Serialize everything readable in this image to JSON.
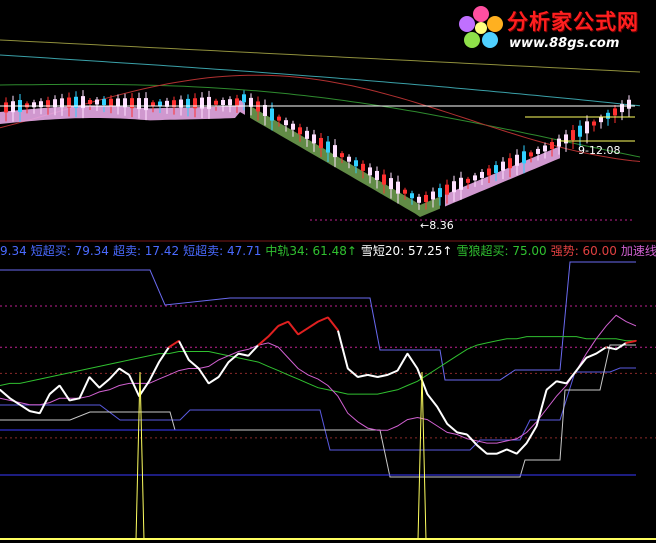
{
  "logo": {
    "title": "分析家公式网",
    "url": "www.88gs.com"
  },
  "colors": {
    "background": "#000000",
    "white_line": "#ffffff",
    "red_line": "#e02020",
    "violet_line": "#d060d0",
    "green_line": "#30c030",
    "blue_line": "#4a5aff",
    "yellow_line": "#ffff60",
    "ribbon_pink": "#e7a9e6",
    "ribbon_green": "#6b9a4e",
    "dotted_line": "#c0208f"
  },
  "price_panel": {
    "high_label": "9-12.08",
    "low_label": "8.36",
    "low_arrow": "←"
  },
  "legend": [
    {
      "text": "9.34",
      "color": "#4a6aff"
    },
    {
      "text": "短超买: 79.34",
      "color": "#4a6aff"
    },
    {
      "text": "超卖: 17.42",
      "color": "#4a6aff"
    },
    {
      "text": "短超卖: 47.71",
      "color": "#4a6aff"
    },
    {
      "text": "中轨34: 61.48↑",
      "color": "#30c030"
    },
    {
      "text": "雪短20: 57.25↑",
      "color": "#ffffff"
    },
    {
      "text": "雪狼超买: 75.00",
      "color": "#30c030"
    },
    {
      "text": "强势: 60.00",
      "color": "#e04040"
    },
    {
      "text": "加速线",
      "color": "#d060d0"
    }
  ],
  "chart_data": {
    "type": "line",
    "title": "",
    "xlabel": "",
    "ylabel": "",
    "ylim": [
      0,
      100
    ],
    "x_count": 65,
    "series": [
      {
        "name": "雪短20",
        "values": [
          40,
          36,
          33,
          30,
          29,
          38,
          42,
          35,
          36,
          46,
          41,
          45,
          50,
          47,
          37,
          44,
          53,
          60,
          63,
          54,
          50,
          43,
          46,
          53,
          57,
          56,
          61,
          65,
          70,
          72,
          66,
          69,
          72,
          74,
          68,
          50,
          46,
          47,
          46,
          47,
          49,
          57,
          50,
          38,
          32,
          24,
          20,
          19,
          14,
          10,
          10,
          12,
          10,
          15,
          23,
          40,
          44,
          43,
          49,
          55,
          57,
          60,
          59,
          62,
          63
        ]
      },
      {
        "name": "中轨34",
        "values": [
          42,
          43,
          43,
          44,
          45,
          46,
          47,
          48,
          49,
          50,
          51,
          52,
          53,
          54,
          55,
          56,
          57,
          57,
          58,
          58,
          58,
          58,
          57,
          56,
          55,
          54,
          53,
          51,
          49,
          47,
          45,
          43,
          41,
          40,
          39,
          38,
          38,
          38,
          38,
          39,
          40,
          42,
          44,
          47,
          50,
          53,
          56,
          59,
          61,
          62,
          63,
          64,
          64,
          65,
          65,
          65,
          65,
          65,
          65,
          64,
          64,
          64,
          64,
          63,
          63
        ]
      },
      {
        "name": "加速线",
        "values": [
          36,
          35,
          34,
          33,
          33,
          34,
          36,
          36,
          36,
          37,
          39,
          40,
          42,
          43,
          43,
          43,
          45,
          47,
          49,
          50,
          50,
          51,
          54,
          56,
          58,
          59,
          61,
          62,
          60,
          55,
          50,
          47,
          45,
          42,
          37,
          29,
          25,
          22,
          21,
          21,
          23,
          26,
          27,
          26,
          23,
          20,
          19,
          17,
          16,
          15,
          15,
          16,
          17,
          20,
          25,
          31,
          37,
          42,
          49,
          57,
          64,
          70,
          75,
          72,
          70
        ]
      },
      {
        "name": "强势",
        "values": [
          60,
          60,
          60,
          60,
          60,
          60,
          60,
          60,
          60,
          60,
          60,
          60,
          60,
          60,
          60,
          60,
          60,
          60,
          60,
          60,
          60,
          60,
          60,
          60,
          60,
          60,
          60,
          60,
          60,
          60,
          60,
          60,
          60,
          60,
          60,
          60,
          60,
          60,
          60,
          60,
          60,
          60,
          60,
          60,
          60,
          60,
          60,
          60,
          60,
          60,
          60,
          60,
          60,
          60,
          60,
          60,
          60,
          60,
          60,
          60,
          60,
          60,
          60,
          60,
          60
        ]
      },
      {
        "name": "雪狼超买",
        "values": [
          75,
          75,
          75,
          75,
          75,
          75,
          75,
          75,
          75,
          75,
          75,
          75,
          75,
          75,
          75,
          75,
          75,
          75,
          75,
          75,
          75,
          75,
          75,
          75,
          75,
          75,
          75,
          75,
          75,
          75,
          75,
          75,
          75,
          75,
          75,
          75,
          75,
          75,
          75,
          75,
          75,
          75,
          75,
          75,
          75,
          75,
          75,
          75,
          75,
          75,
          75,
          75,
          75,
          75,
          75,
          75,
          75,
          75,
          75,
          75,
          75,
          75,
          75,
          75,
          75
        ]
      },
      {
        "name": "短超买",
        "values": [
          79.34,
          79.34,
          79.34,
          79.34,
          79.34,
          79.34,
          79.34,
          79.34,
          79.34,
          79.34,
          79.34,
          79.34,
          79.34,
          79.34,
          79.34,
          79.34,
          79.34,
          79.34,
          79.34,
          79.34,
          79.34,
          79.34,
          79.34,
          79.34,
          79.34,
          79.34,
          79.34,
          79.34,
          79.34,
          79.34,
          79.34,
          79.34,
          79.34,
          79.34,
          79.34,
          79.34,
          79.34,
          79.34,
          79.34,
          79.34,
          79.34,
          79.34,
          79.34,
          79.34,
          79.34,
          79.34,
          79.34,
          79.34,
          79.34,
          79.34,
          79.34,
          79.34,
          79.34,
          79.34,
          79.34,
          79.34,
          79.34,
          79.34,
          79.34,
          79.34,
          79.34,
          79.34,
          79.34,
          79.34,
          79.34
        ]
      },
      {
        "name": "短超卖",
        "values": [
          47.71,
          47.71,
          47.71,
          47.71,
          47.71,
          47.71,
          47.71,
          47.71,
          47.71,
          47.71,
          47.71,
          47.71,
          47.71,
          47.71,
          47.71,
          47.71,
          47.71,
          47.71,
          47.71,
          47.71,
          47.71,
          47.71,
          47.71,
          47.71,
          47.71,
          47.71,
          47.71,
          47.71,
          47.71,
          47.71,
          47.71,
          47.71,
          47.71,
          47.71,
          47.71,
          47.71,
          47.71,
          47.71,
          47.71,
          47.71,
          47.71,
          47.71,
          47.71,
          47.71,
          47.71,
          47.71,
          47.71,
          47.71,
          47.71,
          47.71,
          47.71,
          47.71,
          47.71,
          47.71,
          47.71,
          47.71,
          47.71,
          47.71,
          47.71,
          47.71,
          47.71,
          47.71,
          47.71,
          47.71,
          47.71
        ]
      },
      {
        "name": "超卖",
        "values": [
          17.42,
          17.42,
          17.42,
          17.42,
          17.42,
          17.42,
          17.42,
          17.42,
          17.42,
          17.42,
          17.42,
          17.42,
          17.42,
          17.42,
          17.42,
          17.42,
          17.42,
          17.42,
          17.42,
          17.42,
          17.42,
          17.42,
          17.42,
          17.42,
          17.42,
          17.42,
          17.42,
          17.42,
          17.42,
          17.42,
          17.42,
          17.42,
          17.42,
          17.42,
          17.42,
          17.42,
          17.42,
          17.42,
          17.42,
          17.42,
          17.42,
          17.42,
          17.42,
          17.42,
          17.42,
          17.42,
          17.42,
          17.42,
          17.42,
          17.42,
          17.42,
          17.42,
          17.42,
          17.42,
          17.42,
          17.42,
          17.42,
          17.42,
          17.42,
          17.42,
          17.42,
          17.42,
          17.42,
          17.42,
          17.42
        ]
      }
    ]
  }
}
